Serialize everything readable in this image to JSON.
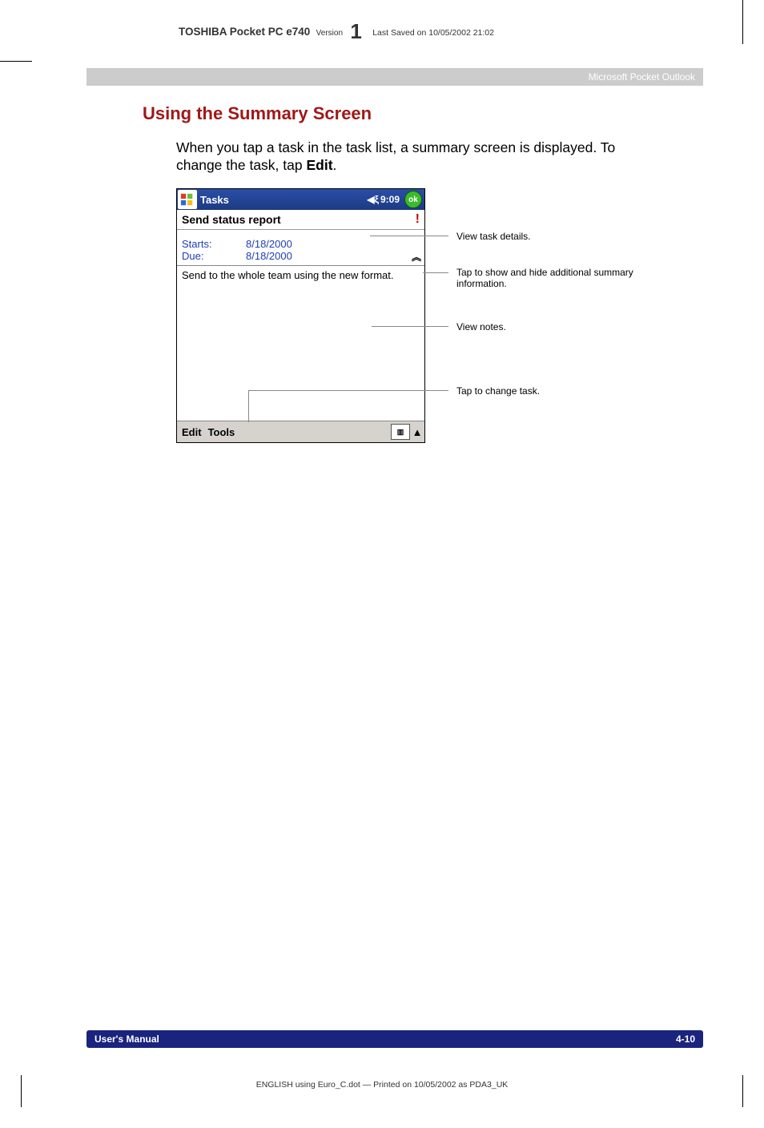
{
  "header": {
    "product_bold": "TOSHIBA Pocket PC e740",
    "version_word": "Version",
    "version_big": "1",
    "saved": "Last Saved on 10/05/2002 21:02"
  },
  "chapter_bar": "Microsoft Pocket Outlook",
  "section_title": "Using the Summary Screen",
  "intro_pre": "When you tap a task in the task list, a summary screen is displayed. To change the task, tap ",
  "intro_bold": "Edit",
  "intro_post": ".",
  "device": {
    "title": "Tasks",
    "time": "9:09",
    "ok": "ok",
    "subject": "Send status report",
    "priority_glyph": "!",
    "date_rows": [
      {
        "label": "Starts:",
        "value": "8/18/2000"
      },
      {
        "label": "Due:",
        "value": "8/18/2000"
      }
    ],
    "collapse_glyph": "︽",
    "notes": "Send to the whole team using the new format.",
    "menu": {
      "edit": "Edit",
      "tools": "Tools",
      "arrow": "▲"
    }
  },
  "callouts": {
    "c1": "View task details.",
    "c2": "Tap to show and hide additional summary information.",
    "c3": "View notes.",
    "c4": "Tap to change task."
  },
  "footer": {
    "left": "User's Manual",
    "right": "4-10",
    "caption": "ENGLISH using  Euro_C.dot — Printed on 10/05/2002 as PDA3_UK"
  }
}
